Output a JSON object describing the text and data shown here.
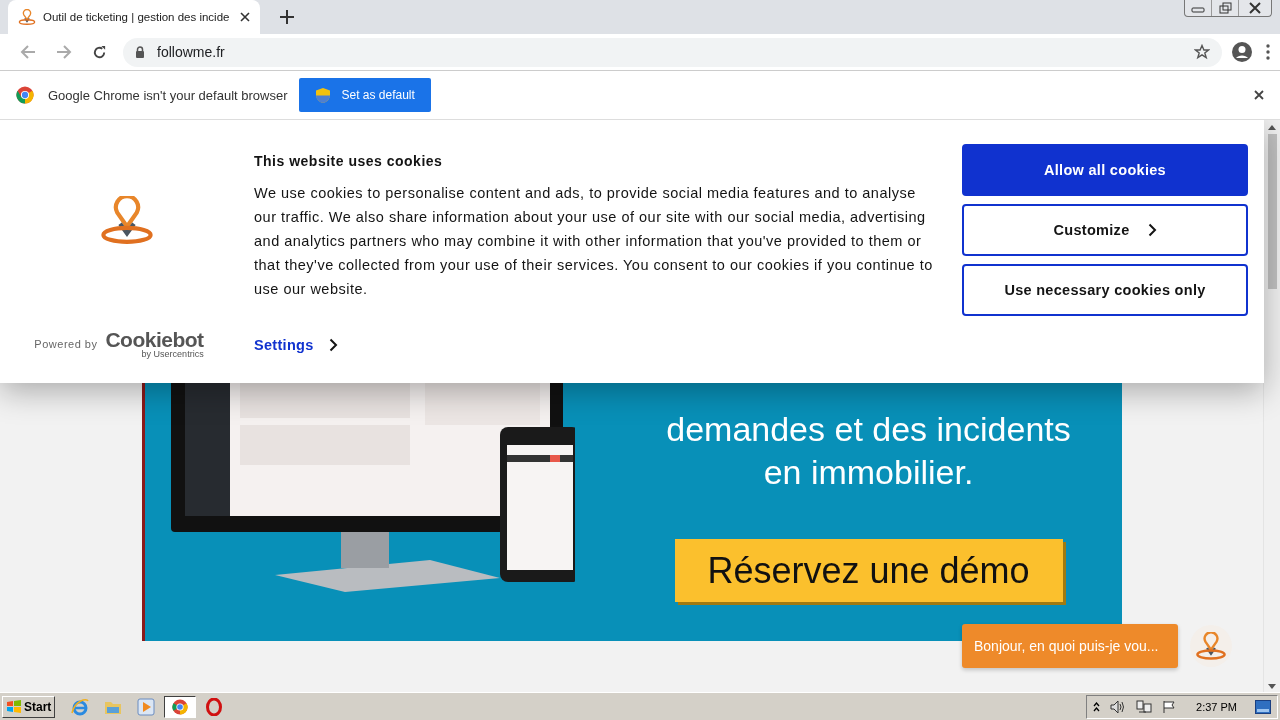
{
  "browser": {
    "tabs": [
      {
        "title": "Outil de ticketing | gestion des incide",
        "selected": true
      }
    ],
    "address": "followme.fr"
  },
  "infobar": {
    "message": "Google Chrome isn't your default browser",
    "button": "Set as default"
  },
  "cookie_banner": {
    "title": "This website uses cookies",
    "body": "We use cookies to personalise content and ads, to provide social media features and to analyse our traffic. We also share information about your use of our site with our social media, advertising and analytics partners who may combine it with other information that you've provided to them or that they've collected from your use of their services. You consent to our cookies if you continue to use our website.",
    "powered_by": "Powered by",
    "brand": "Cookiebot",
    "brand_sub": "by Usercentrics",
    "settings": "Settings",
    "buttons": [
      {
        "label": "Allow all cookies",
        "kind": "primary"
      },
      {
        "label": "Customize",
        "kind": "chevron"
      },
      {
        "label": "Use necessary cookies only",
        "kind": "outline"
      }
    ]
  },
  "hero": {
    "lines": [
      "demandes et des incidents",
      "en immobilier."
    ],
    "cta": "Réservez une démo"
  },
  "chat": {
    "message": "Bonjour, en quoi puis-je vou..."
  },
  "taskbar": {
    "start": "Start",
    "apps": [
      {
        "kind": "ie",
        "active": false
      },
      {
        "kind": "folder",
        "active": false
      },
      {
        "kind": "media",
        "active": false
      },
      {
        "kind": "chrome",
        "active": true
      },
      {
        "kind": "opera",
        "active": false
      }
    ],
    "clock": "2:37 PM"
  }
}
